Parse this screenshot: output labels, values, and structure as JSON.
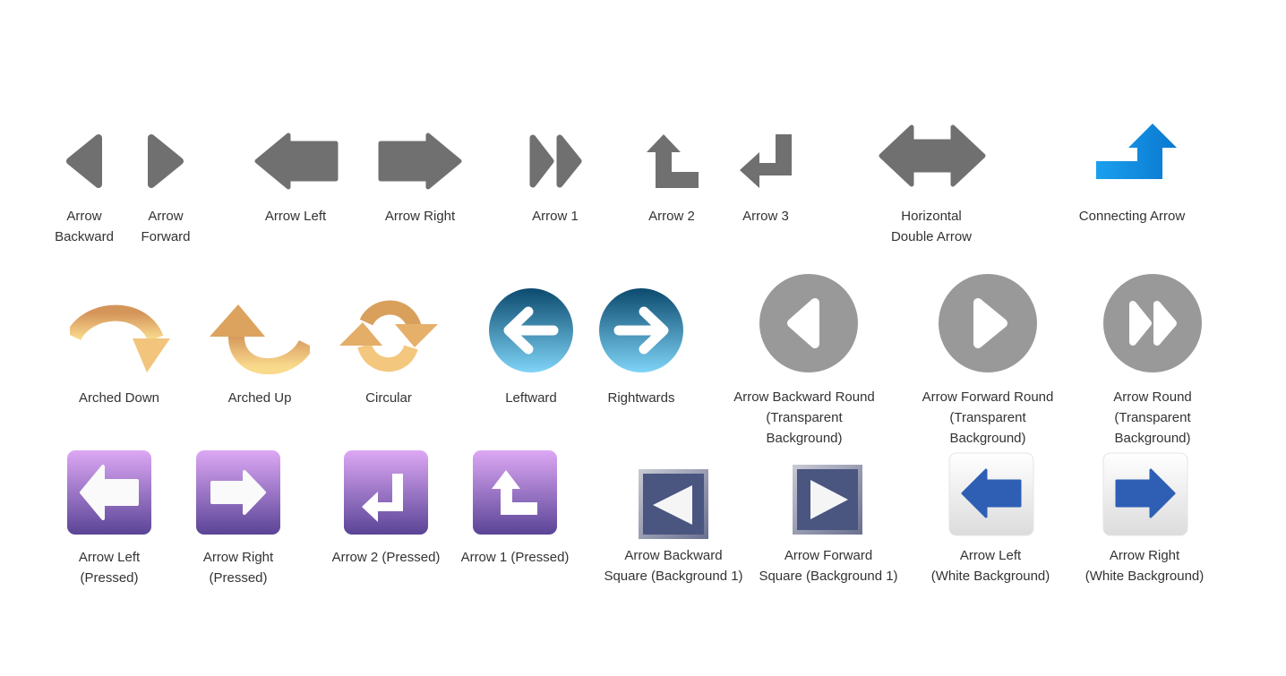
{
  "colors": {
    "grey": "#707070",
    "round_grey": "#999999",
    "orange_top": "#d4955a",
    "orange_bottom": "#f9d98c",
    "blue_top": "#0b4a6e",
    "blue_bottom": "#7fd4f7",
    "purple_top": "#dda8f5",
    "purple_bottom": "#5a4496",
    "navy": "#4a5580",
    "arrow_blue": "#2e5fb5",
    "connect_blue_left": "#1aa0ee",
    "connect_blue_right": "#0a78d0"
  },
  "row1": [
    {
      "label": "Arrow\nBackward",
      "icon": "arrow-backward-icon"
    },
    {
      "label": "Arrow\nForward",
      "icon": "arrow-forward-icon"
    },
    {
      "label": "Arrow Left",
      "icon": "arrow-left-icon"
    },
    {
      "label": "Arrow Right",
      "icon": "arrow-right-icon"
    },
    {
      "label": "Arrow 1",
      "icon": "double-chevron-icon"
    },
    {
      "label": "Arrow 2",
      "icon": "up-turn-arrow-icon"
    },
    {
      "label": "Arrow 3",
      "icon": "return-arrow-icon"
    },
    {
      "label": "Horizontal\nDouble Arrow",
      "icon": "double-arrow-icon"
    },
    {
      "label": "Connecting Arrow",
      "icon": "connecting-arrow-icon"
    }
  ],
  "row2": [
    {
      "label": "Arched Down",
      "icon": "arched-down-icon"
    },
    {
      "label": "Arched Up",
      "icon": "arched-up-icon"
    },
    {
      "label": "Circular",
      "icon": "circular-arrows-icon"
    },
    {
      "label": "Leftward",
      "icon": "leftward-circle-icon"
    },
    {
      "label": "Rightwards",
      "icon": "rightwards-circle-icon"
    },
    {
      "label": "Arrow Backward Round\n(Transparent\nBackground)",
      "icon": "backward-round-icon"
    },
    {
      "label": "Arrow Forward Round\n(Transparent\nBackground)",
      "icon": "forward-round-icon"
    },
    {
      "label": "Arrow Round\n(Transparent\nBackground)",
      "icon": "fast-forward-round-icon"
    }
  ],
  "row3": [
    {
      "label": "Arrow Left\n(Pressed)",
      "icon": "pressed-left-icon"
    },
    {
      "label": "Arrow Right\n(Pressed)",
      "icon": "pressed-right-icon"
    },
    {
      "label": "Arrow 2 (Pressed)",
      "icon": "pressed-return-icon"
    },
    {
      "label": "Arrow 1 (Pressed)",
      "icon": "pressed-up-turn-icon"
    },
    {
      "label": "Arrow Backward\nSquare (Background 1)",
      "icon": "square-backward-icon"
    },
    {
      "label": "Arrow Forward\nSquare (Background 1)",
      "icon": "square-forward-icon"
    },
    {
      "label": "Arrow Left\n(White Background)",
      "icon": "white-left-icon"
    },
    {
      "label": "Arrow Right\n(White Background)",
      "icon": "white-right-icon"
    }
  ]
}
